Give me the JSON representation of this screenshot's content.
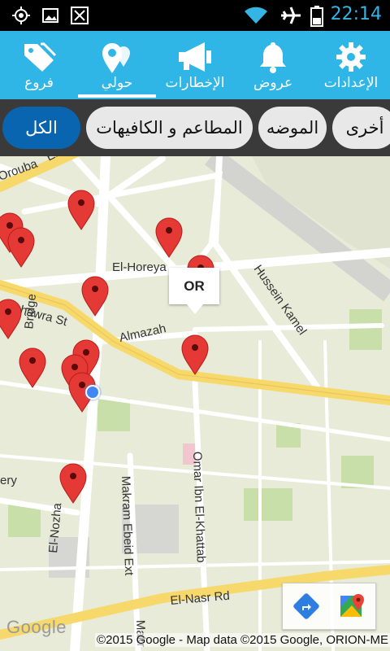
{
  "status_bar": {
    "time": "22:14",
    "icons": [
      "gps-icon",
      "image-icon",
      "app-notification-icon",
      "wifi-icon",
      "airplane-icon",
      "battery-icon"
    ]
  },
  "nav": {
    "items": [
      {
        "label": "الإعدادات",
        "icon": "gear-icon"
      },
      {
        "label": "عروض",
        "icon": "bell-icon"
      },
      {
        "label": "الإخطارات",
        "icon": "megaphone-icon"
      },
      {
        "label": "حولي",
        "icon": "location-pin-icon",
        "active": true
      },
      {
        "label": "فروع",
        "icon": "tags-icon"
      }
    ],
    "accent": "#30b6e6"
  },
  "filters": {
    "chips": [
      {
        "label": "أخرى"
      },
      {
        "label": "الموضه"
      },
      {
        "label": "المطاعم و الكافيهات"
      },
      {
        "label": "الكل",
        "selected": true
      }
    ],
    "selected_color": "#0a65b0"
  },
  "map": {
    "callout": "OR",
    "streets": [
      "Orouba",
      "El-Gala",
      "El-Horeya",
      "Hussein Kamel",
      "Almazah",
      "Merghany",
      "Bridge",
      "Makram Ebeid Ext",
      "Omar Ibn El-Khattab",
      "El-Nozha",
      "El-Nasr Rd",
      "Makr",
      "ery",
      "hawra St"
    ],
    "logo": "Google",
    "attribution": "©2015 Google - Map data ©2015 Google, ORION-ME",
    "marker_color": "#e53935",
    "my_location_color": "#4285f4"
  }
}
